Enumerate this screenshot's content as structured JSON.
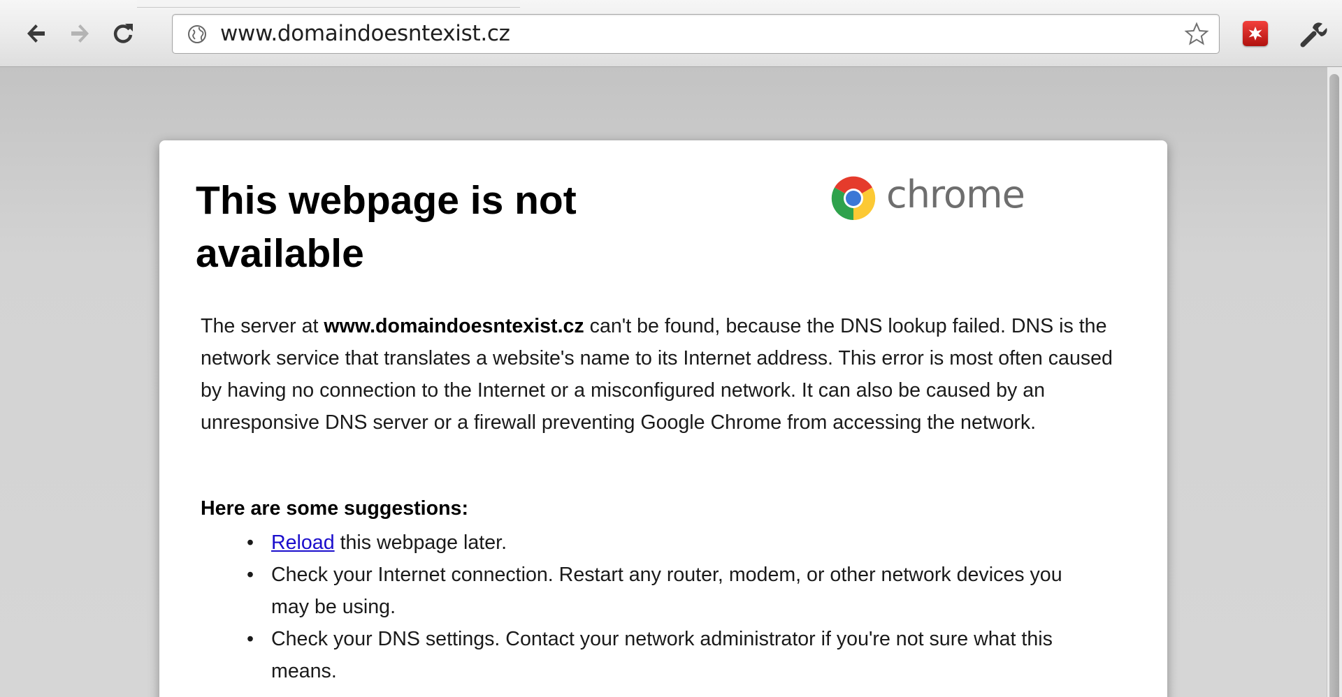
{
  "browser": {
    "address_bar": {
      "url": "www.domaindoesntexist.cz"
    },
    "icons": {
      "back": "back-arrow-icon",
      "forward": "forward-arrow-icon",
      "reload": "reload-icon",
      "site": "globe-icon",
      "bookmark": "star-icon",
      "extension": "extension-icon",
      "menu": "wrench-icon"
    }
  },
  "error_page": {
    "title": "This webpage is not available",
    "brand_text": "chrome",
    "description_prefix": "The server at ",
    "description_host": "www.domaindoesntexist.cz",
    "description_suffix": " can't be found, because the DNS lookup failed. DNS is the network service that translates a website's name to its Internet address. This error is most often caused by having no connection to the Internet or a misconfigured network. It can also be caused by an unresponsive DNS server or a firewall preventing Google Chrome from accessing the network.",
    "suggestions_heading": "Here are some suggestions:",
    "suggestions": {
      "reload_link": "Reload",
      "reload_rest": " this webpage later.",
      "item_2": "Check your Internet connection. Restart any router, modem, or other network devices you may be using.",
      "item_3": "Check your DNS settings. Contact your network administrator if you're not sure what this means."
    }
  },
  "colors": {
    "link": "#1a0dcc",
    "extension_red": "#d2231f",
    "background": "#d3d3d3"
  }
}
